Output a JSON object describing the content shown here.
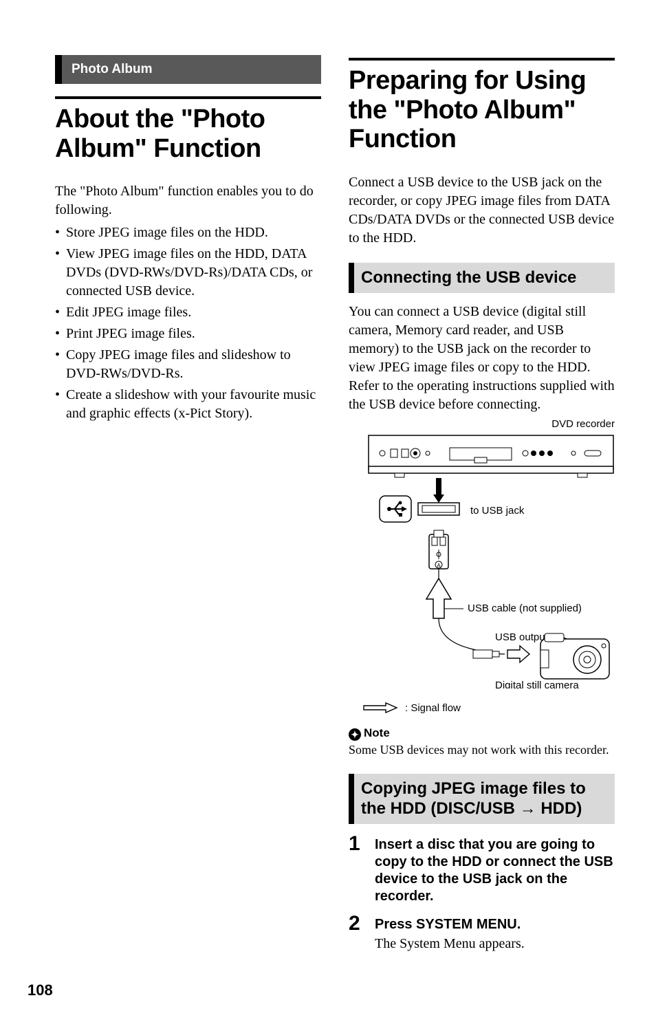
{
  "left": {
    "section_tag": "Photo Album",
    "heading": "About the \"Photo Album\" Function",
    "intro": "The \"Photo Album\" function enables you to do following.",
    "bullets": [
      "Store JPEG image files on the HDD.",
      "View JPEG image files on the HDD, DATA DVDs (DVD-RWs/DVD-Rs)/DATA CDs, or connected USB device.",
      "Edit JPEG image files.",
      "Print JPEG image files.",
      "Copy JPEG image files and slideshow to DVD-RWs/DVD-Rs.",
      "Create a slideshow with your favourite music and graphic effects (x-Pict Story)."
    ]
  },
  "right": {
    "heading": "Preparing for Using the \"Photo Album\" Function",
    "intro": "Connect a USB device to the USB jack on the recorder, or copy JPEG image files from DATA CDs/DATA DVDs or the connected USB device to the HDD.",
    "sub1": {
      "title": "Connecting the USB device",
      "body": "You can connect a USB device (digital still camera, Memory card reader, and USB memory) to the USB jack on the recorder to view JPEG image files or copy to the HDD. Refer to the operating instructions supplied with the USB device before connecting.",
      "diagram": {
        "recorder_label": "DVD recorder",
        "to_usb_label": "to USB jack",
        "cable_label": "USB cable (not supplied)",
        "usb_output_label": "USB output",
        "camera_label": "Digital still camera",
        "signal_flow_label": ": Signal flow"
      },
      "note_head": "Note",
      "note_body": "Some USB devices may not work with this recorder."
    },
    "sub2": {
      "title": "Copying JPEG image files to the HDD (DISC/USB → HDD)",
      "steps": [
        {
          "num": "1",
          "title": "Insert a disc that you are going to copy to the HDD or connect the USB device to the USB jack on the recorder.",
          "desc": ""
        },
        {
          "num": "2",
          "title": "Press SYSTEM MENU.",
          "desc": "The System Menu appears."
        }
      ]
    }
  },
  "page_number": "108"
}
